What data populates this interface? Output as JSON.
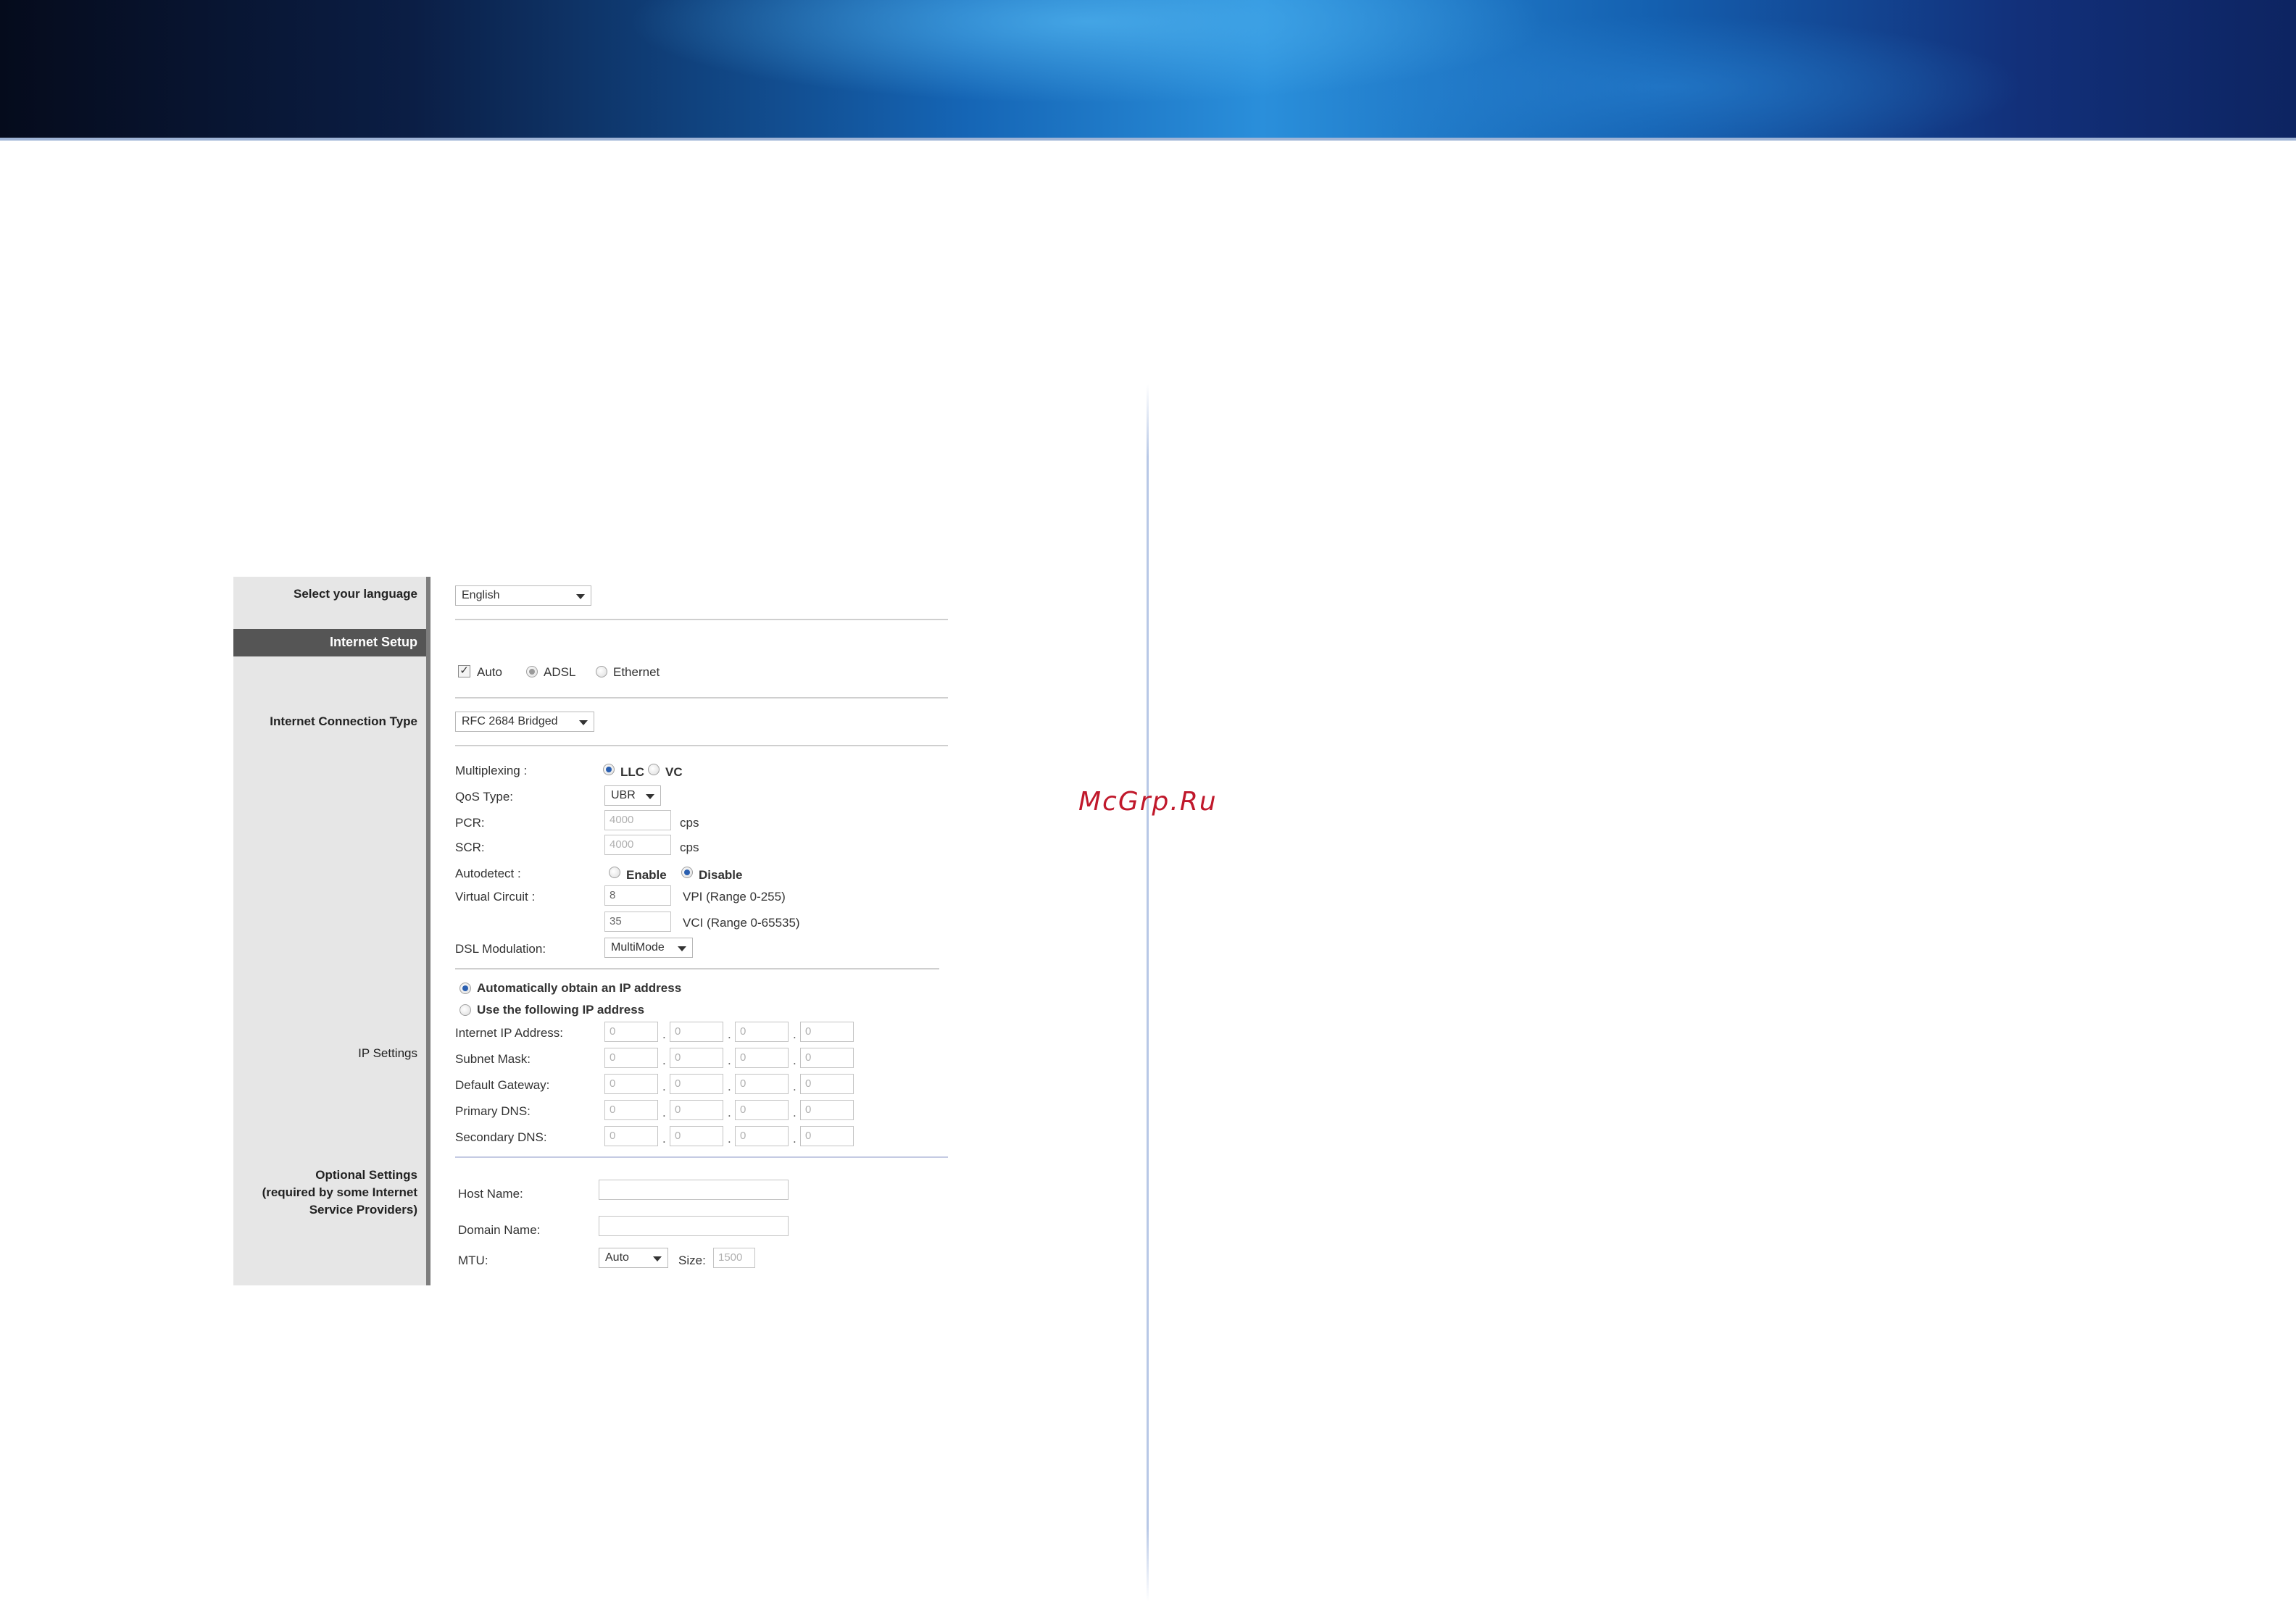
{
  "watermark": "McGrp.Ru",
  "sidebar": {
    "select_language": "Select your language",
    "internet_setup": "Internet Setup",
    "connection_type": "Internet Connection Type",
    "ip_settings": "IP Settings",
    "optional_line1": "Optional Settings",
    "optional_line2": "(required by some Internet",
    "optional_line3": "Service Providers)"
  },
  "language": {
    "value": "English"
  },
  "wan_mode": {
    "auto": "Auto",
    "adsl": "ADSL",
    "ethernet": "Ethernet",
    "auto_checked": true,
    "selected": "ADSL"
  },
  "connection_type": {
    "value": "RFC 2684 Bridged"
  },
  "dsl": {
    "multiplexing_label": "Multiplexing :",
    "llc": "LLC",
    "vc": "VC",
    "multiplexing_selected": "LLC",
    "qos_label": "QoS Type:",
    "qos_value": "UBR",
    "pcr_label": "PCR:",
    "pcr_value": "4000",
    "scr_label": "SCR:",
    "scr_value": "4000",
    "cps": "cps",
    "autodetect_label": "Autodetect :",
    "enable": "Enable",
    "disable": "Disable",
    "autodetect_selected": "Disable",
    "vc_label": "Virtual Circuit :",
    "vpi_value": "8",
    "vpi_range": "VPI (Range 0-255)",
    "vci_value": "35",
    "vci_range": "VCI (Range 0-65535)",
    "modulation_label": "DSL Modulation:",
    "modulation_value": "MultiMode"
  },
  "ip": {
    "auto_obtain": "Automatically obtain an IP address",
    "use_following": "Use the following IP address",
    "selected": "auto",
    "rows": [
      {
        "label": "Internet IP Address:",
        "octets": [
          "0",
          "0",
          "0",
          "0"
        ]
      },
      {
        "label": "Subnet Mask:",
        "octets": [
          "0",
          "0",
          "0",
          "0"
        ]
      },
      {
        "label": "Default Gateway:",
        "octets": [
          "0",
          "0",
          "0",
          "0"
        ]
      },
      {
        "label": "Primary DNS:",
        "octets": [
          "0",
          "0",
          "0",
          "0"
        ]
      },
      {
        "label": "Secondary DNS:",
        "octets": [
          "0",
          "0",
          "0",
          "0"
        ]
      }
    ]
  },
  "optional": {
    "host_label": "Host Name:",
    "host_value": "",
    "domain_label": "Domain Name:",
    "domain_value": "",
    "mtu_label": "MTU:",
    "mtu_value": "Auto",
    "size_label": "Size:",
    "size_value": "1500"
  }
}
